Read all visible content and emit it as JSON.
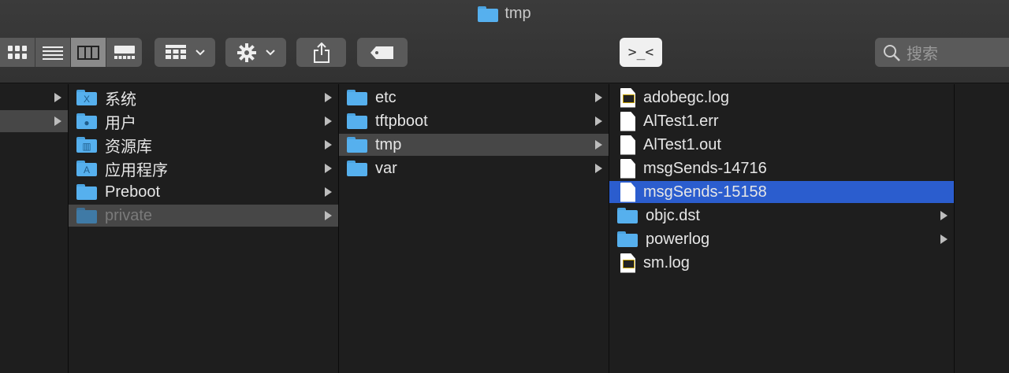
{
  "window": {
    "title": "tmp"
  },
  "toolbar": {
    "view_modes": [
      "icon-view",
      "list-view",
      "column-view",
      "gallery-view"
    ],
    "active_view": "column-view",
    "group_label": "group-icon",
    "action_label": "gear-icon",
    "share_label": "share-icon",
    "tag_label": "tag-icon",
    "terminal_label": ">_<",
    "search": {
      "placeholder": "搜索"
    }
  },
  "columns": [
    {
      "items": [
        {
          "label": "",
          "has_children": true,
          "state": "normal"
        },
        {
          "label": "",
          "has_children": true,
          "state": "selected"
        }
      ]
    },
    {
      "items": [
        {
          "label": "系统",
          "kind": "folder",
          "glyph": "X",
          "has_children": true,
          "state": "normal"
        },
        {
          "label": "用户",
          "kind": "folder",
          "glyph": "●",
          "has_children": true,
          "state": "normal"
        },
        {
          "label": "资源库",
          "kind": "folder",
          "glyph": "▥",
          "has_children": true,
          "state": "normal"
        },
        {
          "label": "应用程序",
          "kind": "folder",
          "glyph": "A",
          "has_children": true,
          "state": "normal"
        },
        {
          "label": "Preboot",
          "kind": "folder",
          "glyph": "",
          "has_children": true,
          "state": "normal"
        },
        {
          "label": "private",
          "kind": "folder",
          "glyph": "",
          "has_children": true,
          "state": "selected-dim"
        }
      ]
    },
    {
      "items": [
        {
          "label": "etc",
          "kind": "folder",
          "has_children": true,
          "state": "normal"
        },
        {
          "label": "tftpboot",
          "kind": "folder",
          "has_children": true,
          "state": "normal"
        },
        {
          "label": "tmp",
          "kind": "folder",
          "has_children": true,
          "state": "selected"
        },
        {
          "label": "var",
          "kind": "folder",
          "has_children": true,
          "state": "normal"
        }
      ]
    },
    {
      "items": [
        {
          "label": "adobegc.log",
          "kind": "log",
          "has_children": false,
          "state": "normal"
        },
        {
          "label": "AlTest1.err",
          "kind": "file",
          "has_children": false,
          "state": "normal"
        },
        {
          "label": "AlTest1.out",
          "kind": "file",
          "has_children": false,
          "state": "normal"
        },
        {
          "label": "msgSends-14716",
          "kind": "file",
          "has_children": false,
          "state": "normal"
        },
        {
          "label": "msgSends-15158",
          "kind": "file",
          "has_children": false,
          "state": "highlight"
        },
        {
          "label": "objc.dst",
          "kind": "folder",
          "has_children": true,
          "state": "normal"
        },
        {
          "label": "powerlog",
          "kind": "folder",
          "has_children": true,
          "state": "normal"
        },
        {
          "label": "sm.log",
          "kind": "log",
          "has_children": false,
          "state": "normal"
        }
      ]
    },
    {
      "items": []
    }
  ]
}
